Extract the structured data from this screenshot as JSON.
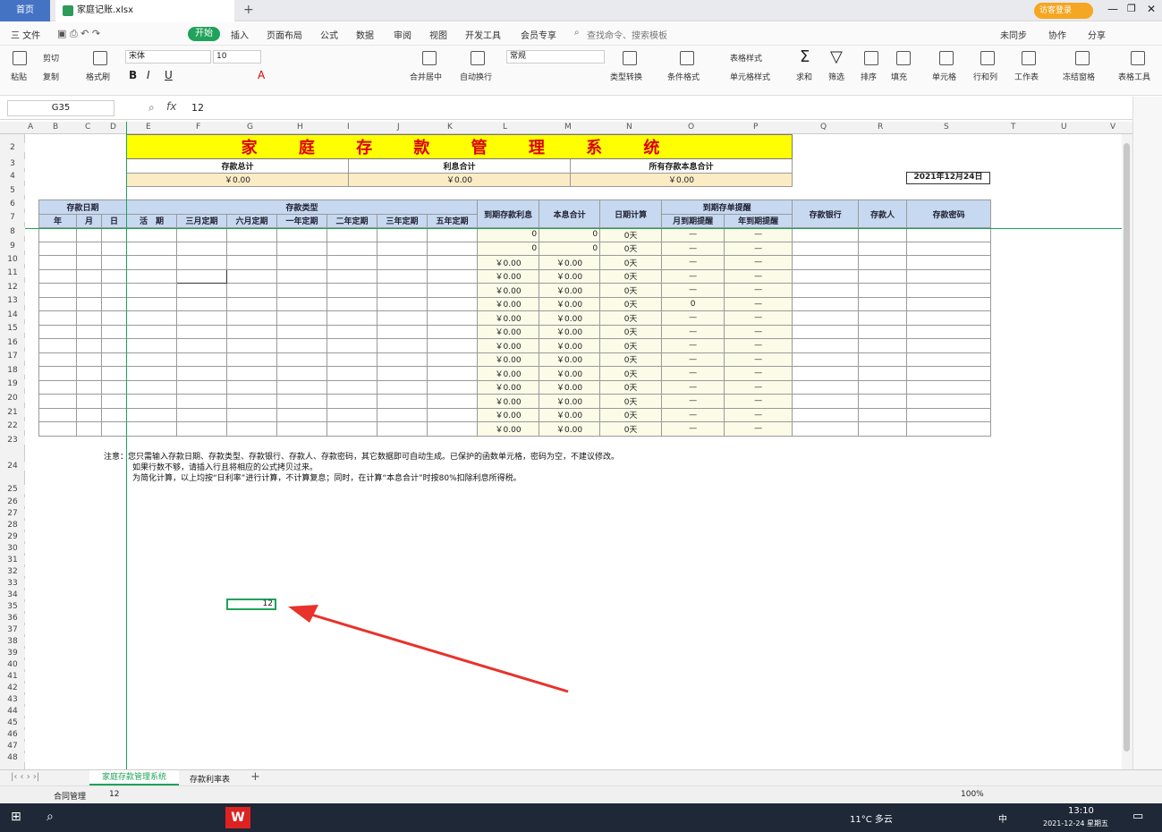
{
  "app": {
    "home_tab": "首页",
    "file_tab": "家庭记账.xlsx",
    "login": "访客登录"
  },
  "menu": {
    "file": "三 文件",
    "start": "开始",
    "items": [
      "插入",
      "页面布局",
      "公式",
      "数据",
      "审阅",
      "视图",
      "开发工具",
      "会员专享"
    ],
    "search": "查找命令、搜索模板",
    "sync": "未同步",
    "collab": "协作",
    "share": "分享"
  },
  "ribbon": {
    "paste": "粘贴",
    "cut": "剪切",
    "copy": "复制",
    "format_painter": "格式刷",
    "font": "宋体",
    "size": "10",
    "merge": "合并居中",
    "wrap": "自动换行",
    "numfmt": "常规",
    "convert": "类型转换",
    "condfmt": "条件格式",
    "tablestyle": "表格样式",
    "cellstyle": "单元格样式",
    "sum": "求和",
    "filter": "筛选",
    "sort": "排序",
    "fill": "填充",
    "cell": "单元格",
    "rowcol": "行和列",
    "sheet": "工作表",
    "freeze": "冻结窗格",
    "tabletool": "表格工具"
  },
  "formula": {
    "cell_ref": "G35",
    "fx": "fx",
    "value": "12"
  },
  "columns": [
    "A",
    "B",
    "C",
    "D",
    "E",
    "F",
    "G",
    "H",
    "I",
    "J",
    "K",
    "L",
    "M",
    "N",
    "O",
    "P",
    "Q",
    "R",
    "S",
    "T",
    "U",
    "V"
  ],
  "rows": [
    "2",
    "3",
    "4",
    "5",
    "6",
    "7",
    "8",
    "9",
    "10",
    "11",
    "12",
    "13",
    "14",
    "15",
    "16",
    "17",
    "18",
    "19",
    "20",
    "21",
    "22",
    "23",
    "24",
    "25",
    "26",
    "27",
    "28",
    "29",
    "30",
    "31",
    "32",
    "33",
    "34",
    "35",
    "36",
    "37",
    "38",
    "39",
    "40",
    "41",
    "42",
    "43",
    "44",
    "45",
    "46",
    "47",
    "48",
    "49"
  ],
  "sheet": {
    "title": "家 庭 存 款 管 理 系 统",
    "summary_labels": [
      "存款总计",
      "利息合计",
      "所有存款本息合计"
    ],
    "summary_values": [
      "￥0.00",
      "￥0.00",
      "￥0.00"
    ],
    "date": "2021年12月24日",
    "group_headers": {
      "date": "存款日期",
      "type": "存款类型",
      "interest": "到期存款利息",
      "total": "本息合计",
      "days": "日期计算",
      "remind": "到期存单提醒",
      "bank": "存款银行",
      "person": "存款人",
      "password": "存款密码"
    },
    "sub_headers": [
      "年",
      "月",
      "日",
      "活　期",
      "三月定期",
      "六月定期",
      "一年定期",
      "二年定期",
      "三年定期",
      "五年定期",
      "月到期提醒",
      "年到期提醒"
    ],
    "data_rows": [
      [
        "0",
        "0",
        "0天",
        "—",
        "—"
      ],
      [
        "0",
        "0",
        "0天",
        "—",
        "—"
      ],
      [
        "￥0.00",
        "￥0.00",
        "0天",
        "—",
        "—"
      ],
      [
        "￥0.00",
        "￥0.00",
        "0天",
        "—",
        "—"
      ],
      [
        "￥0.00",
        "￥0.00",
        "0天",
        "—",
        "—"
      ],
      [
        "￥0.00",
        "￥0.00",
        "0天",
        "0",
        "—"
      ],
      [
        "￥0.00",
        "￥0.00",
        "0天",
        "—",
        "—"
      ],
      [
        "￥0.00",
        "￥0.00",
        "0天",
        "—",
        "—"
      ],
      [
        "￥0.00",
        "￥0.00",
        "0天",
        "—",
        "—"
      ],
      [
        "￥0.00",
        "￥0.00",
        "0天",
        "—",
        "—"
      ],
      [
        "￥0.00",
        "￥0.00",
        "0天",
        "—",
        "—"
      ],
      [
        "￥0.00",
        "￥0.00",
        "0天",
        "—",
        "—"
      ],
      [
        "￥0.00",
        "￥0.00",
        "0天",
        "—",
        "—"
      ],
      [
        "￥0.00",
        "￥0.00",
        "0天",
        "—",
        "—"
      ],
      [
        "￥0.00",
        "￥0.00",
        "0天",
        "—",
        "—"
      ]
    ],
    "note_label": "注意：",
    "notes": [
      "您只需输入存款日期、存款类型、存款银行、存款人、存款密码，其它数据即可自动生成。已保护的函数单元格，密码为空，不建议修改。",
      "如果行数不够，请插入行且将相应的公式拷贝过来。",
      "为简化计算，以上均按“日利率”进行计算，不计算复息；同时，在计算“本息合计”时按80%扣除利息所得税。"
    ],
    "selected_value": "12"
  },
  "tabs": {
    "active": "家庭存款管理系统",
    "other": "存款利率表"
  },
  "status": {
    "contract": "合同管理",
    "value": "12",
    "zoom": "100%"
  },
  "taskbar": {
    "weather": "11°C 多云",
    "ime": "中",
    "time": "13:10",
    "date": "2021-12-24 星期五"
  },
  "colors": {
    "accent": "#1fa25a",
    "title_bg": "#ffff00",
    "title_fg": "#dd0000",
    "header_bg": "#c6d9f1",
    "arrow": "#e8322b"
  }
}
